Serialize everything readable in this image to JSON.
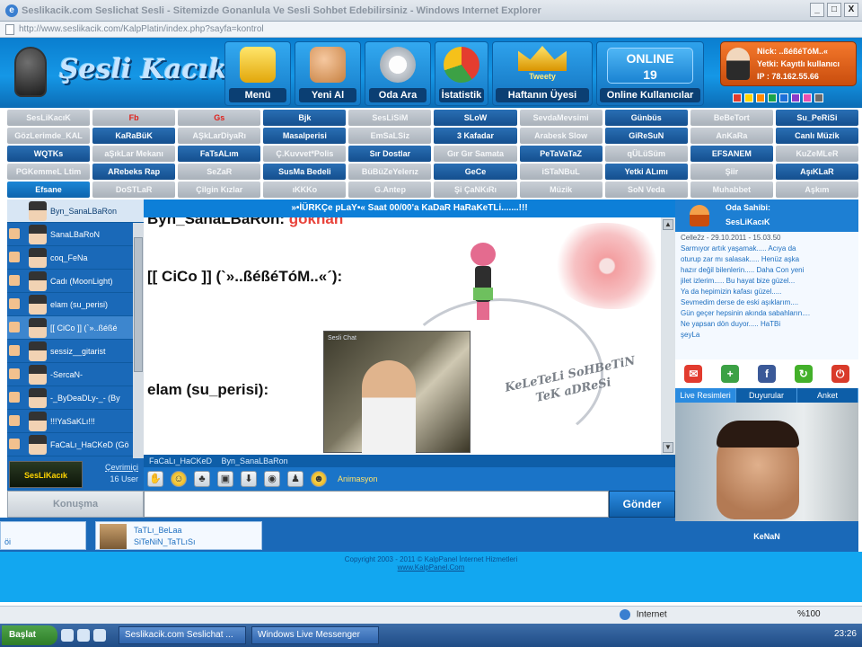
{
  "window": {
    "title": "Seslikacik.com Seslichat Sesli - Sitemizde Gonanlula Ve Sesli Sohbet Edebilirsiniz - Windows Internet Explorer",
    "url": "http://www.seslikacik.com/KalpPlatin/index.php?sayfa=kontrol",
    "controls": [
      "_",
      "□",
      "X"
    ]
  },
  "header": {
    "logo_text": "Şesli Kacık",
    "tiles": [
      {
        "label": "Menü",
        "icon": "notepad-icon"
      },
      {
        "label": "Yeni Al",
        "icon": "add-user-icon"
      },
      {
        "label": "Oda Ara",
        "icon": "magnifier-icon"
      },
      {
        "label": "İstatistik",
        "icon": "pie-chart-icon"
      }
    ],
    "week_tile": {
      "label": "Haftanın Üyesi",
      "name": "Tweety",
      "icon": "crown-icon"
    },
    "online_tile": {
      "word": "ONLINE",
      "count": "19",
      "label": "Online Kullanıcılar"
    },
    "user_box": {
      "name": "Nick: ..ßéßéTóM..«",
      "status": "Yetki: Kayıtlı kullanıcı",
      "ip": "IP : 78.162.55.66"
    },
    "theme_colors": [
      "#e23b2e",
      "#ffd400",
      "#ff8a00",
      "#19a34a",
      "#1c6fd8",
      "#8a3cc8",
      "#e84fb0",
      "#6a6a6a"
    ]
  },
  "rooms": [
    [
      "SesLiKacıK",
      "Fb",
      "Gs",
      "Bjk",
      "SesLiSiM",
      "SLoW",
      "SevdaMevsimi",
      "Günbüs",
      "BeBeTort",
      "Su_PeRiSi"
    ],
    [
      "GözLerimde_KAL",
      "KaRaBüK",
      "AŞkLarDiyaRı",
      "Masalperisi",
      "EmSaLSiz",
      "3 Kafadar",
      "Arabesk Slow",
      "GiReSuN",
      "AnKaRa",
      "Canlı Müzik"
    ],
    [
      "WQTKs",
      "aŞıkLar Mekanı",
      "FaTsALım",
      "Ç.Kuvvet*Polis",
      "Sır Dostlar",
      "Gır Gır Samata",
      "PeTaVaTaZ",
      "qÜLüSüm",
      "EFSANEM",
      "KuZeMLeR"
    ],
    [
      "PGKemmeL Ltim",
      "ARebeks Rap",
      "SeZaR",
      "SusMa Bedeli",
      "BüBüZeYelerız",
      "GeCe",
      "iSTaNBuL",
      "Yetki ALımı",
      "Şiir",
      "AşıKLaR"
    ],
    [
      "Efsane",
      "DoSTLaR",
      "Çilgin Kızlar",
      "ıKKKo",
      "G.Antep",
      "Şi ÇaNKıRı",
      "Müzik",
      "SoN Veda",
      "Muhabbet",
      "Aşkım"
    ]
  ],
  "room_styles": [
    [
      "gray",
      "red",
      "red",
      "blue",
      "gray",
      "blue",
      "gray",
      "blue",
      "gray",
      "blue"
    ],
    [
      "gray",
      "blue",
      "gray",
      "blue",
      "gray",
      "blue",
      "gray",
      "blue",
      "gray",
      "blue"
    ],
    [
      "blue",
      "gray",
      "blue",
      "gray",
      "blue",
      "gray",
      "blue",
      "gray",
      "blue",
      "gray"
    ],
    [
      "gray",
      "blue",
      "gray",
      "blue",
      "gray",
      "blue",
      "gray",
      "blue",
      "gray",
      "blue"
    ],
    [
      "active",
      "gray",
      "gray",
      "gray",
      "gray",
      "gray",
      "gray",
      "gray",
      "gray",
      "gray"
    ]
  ],
  "users": [
    {
      "name": "Byn_SanaLBaRon",
      "state": "first"
    },
    {
      "name": "SanaLBaRoN",
      "state": ""
    },
    {
      "name": "coq_FeNa",
      "state": ""
    },
    {
      "name": "Cadı (MoonLight)",
      "state": ""
    },
    {
      "name": "elam (su_perisi)",
      "state": ""
    },
    {
      "name": "[[ CiCo ]] (`»..ßéßé",
      "state": "sel"
    },
    {
      "name": "sessiz__gitarist",
      "state": ""
    },
    {
      "name": "-SercaN-",
      "state": ""
    },
    {
      "name": "-_ByDeaDLy-_- (By",
      "state": ""
    },
    {
      "name": "!!!YaSaKLı!!!",
      "state": ""
    },
    {
      "name": "FaCaLı_HaCKeD (Gö",
      "state": ""
    }
  ],
  "left_bottom": {
    "logo": "SesLiKacık",
    "online_label": "Çevrimiçi",
    "online_count": "16 User",
    "tab_label": "Konuşma"
  },
  "chat": {
    "topic": "»•İÜRKÇe pLaY•« Saat 00/00'a KaDaR HaRaKeTLi.......!!!",
    "messages": [
      {
        "nick": "Byn_SanaLBaRon:",
        "text": "gökhan"
      },
      {
        "nick": "[[ CiCo ]] (`»..ßéßéTóM..«´):",
        "text": ""
      },
      {
        "nick": "elam (su_perisi):",
        "text": ""
      }
    ],
    "image_caption": "Sesli Chat",
    "stamp_line1": "KeLeTeLi SoHBeTiN",
    "stamp_line2": "TeK aDReSi"
  },
  "private_tabs": [
    "FaCaLı_HaCKeD",
    "Byn_SanaLBaRon"
  ],
  "emote_bar": {
    "animation_label": "Animasyon"
  },
  "input": {
    "placeholder": "",
    "send_label": "Gönder"
  },
  "owner": {
    "label": "Oda Sahibi:",
    "name": "SesLiKacıK"
  },
  "guestbook": {
    "head": "Celle2z - 29.10.2011 - 15.03.50",
    "lines": [
      "Sarmıyor artık yaşamak..... Acıya da",
      "oturup zar mı salasak..... Henüz aşka",
      "hazır değil bilenlerin..... Daha Con yeni",
      "jilet izlerim..... Bu hayat bize güzel...",
      "Ya da hepimizin kafası güzel.....",
      "Sevmedim derse de eski aşıklarım....",
      "Gün geçer hepsinin akında sabahların....",
      "Ne yapsan dön duyor..... HaTBi",
      "şeyLa"
    ]
  },
  "social_icons": [
    "mail-icon",
    "add-friend-icon",
    "facebook-icon",
    "refresh-icon",
    "power-icon"
  ],
  "right_tabs": [
    "Live Resimleri",
    "Duyurular",
    "Anket"
  ],
  "cam_user": "KeNaN",
  "footer": {
    "left_card": {
      "line1": "",
      "line2": "öi"
    },
    "right_card": {
      "line1": "TaTLı_BeLaa",
      "line2": "SiTeNiN_TaTLıSı"
    },
    "copyright": "Copyright 2003 - 2011 © KalpPanel İnternet Hizmetleri",
    "link": "www.KalpPanel.Com"
  },
  "statusbar": {
    "zone": "Internet",
    "zoom": "%100"
  },
  "taskbar": {
    "start": "Başlat",
    "tasks": [
      "Seslikacik.com Seslichat ...",
      "Windows Live Messenger"
    ],
    "clock": "23:26"
  }
}
